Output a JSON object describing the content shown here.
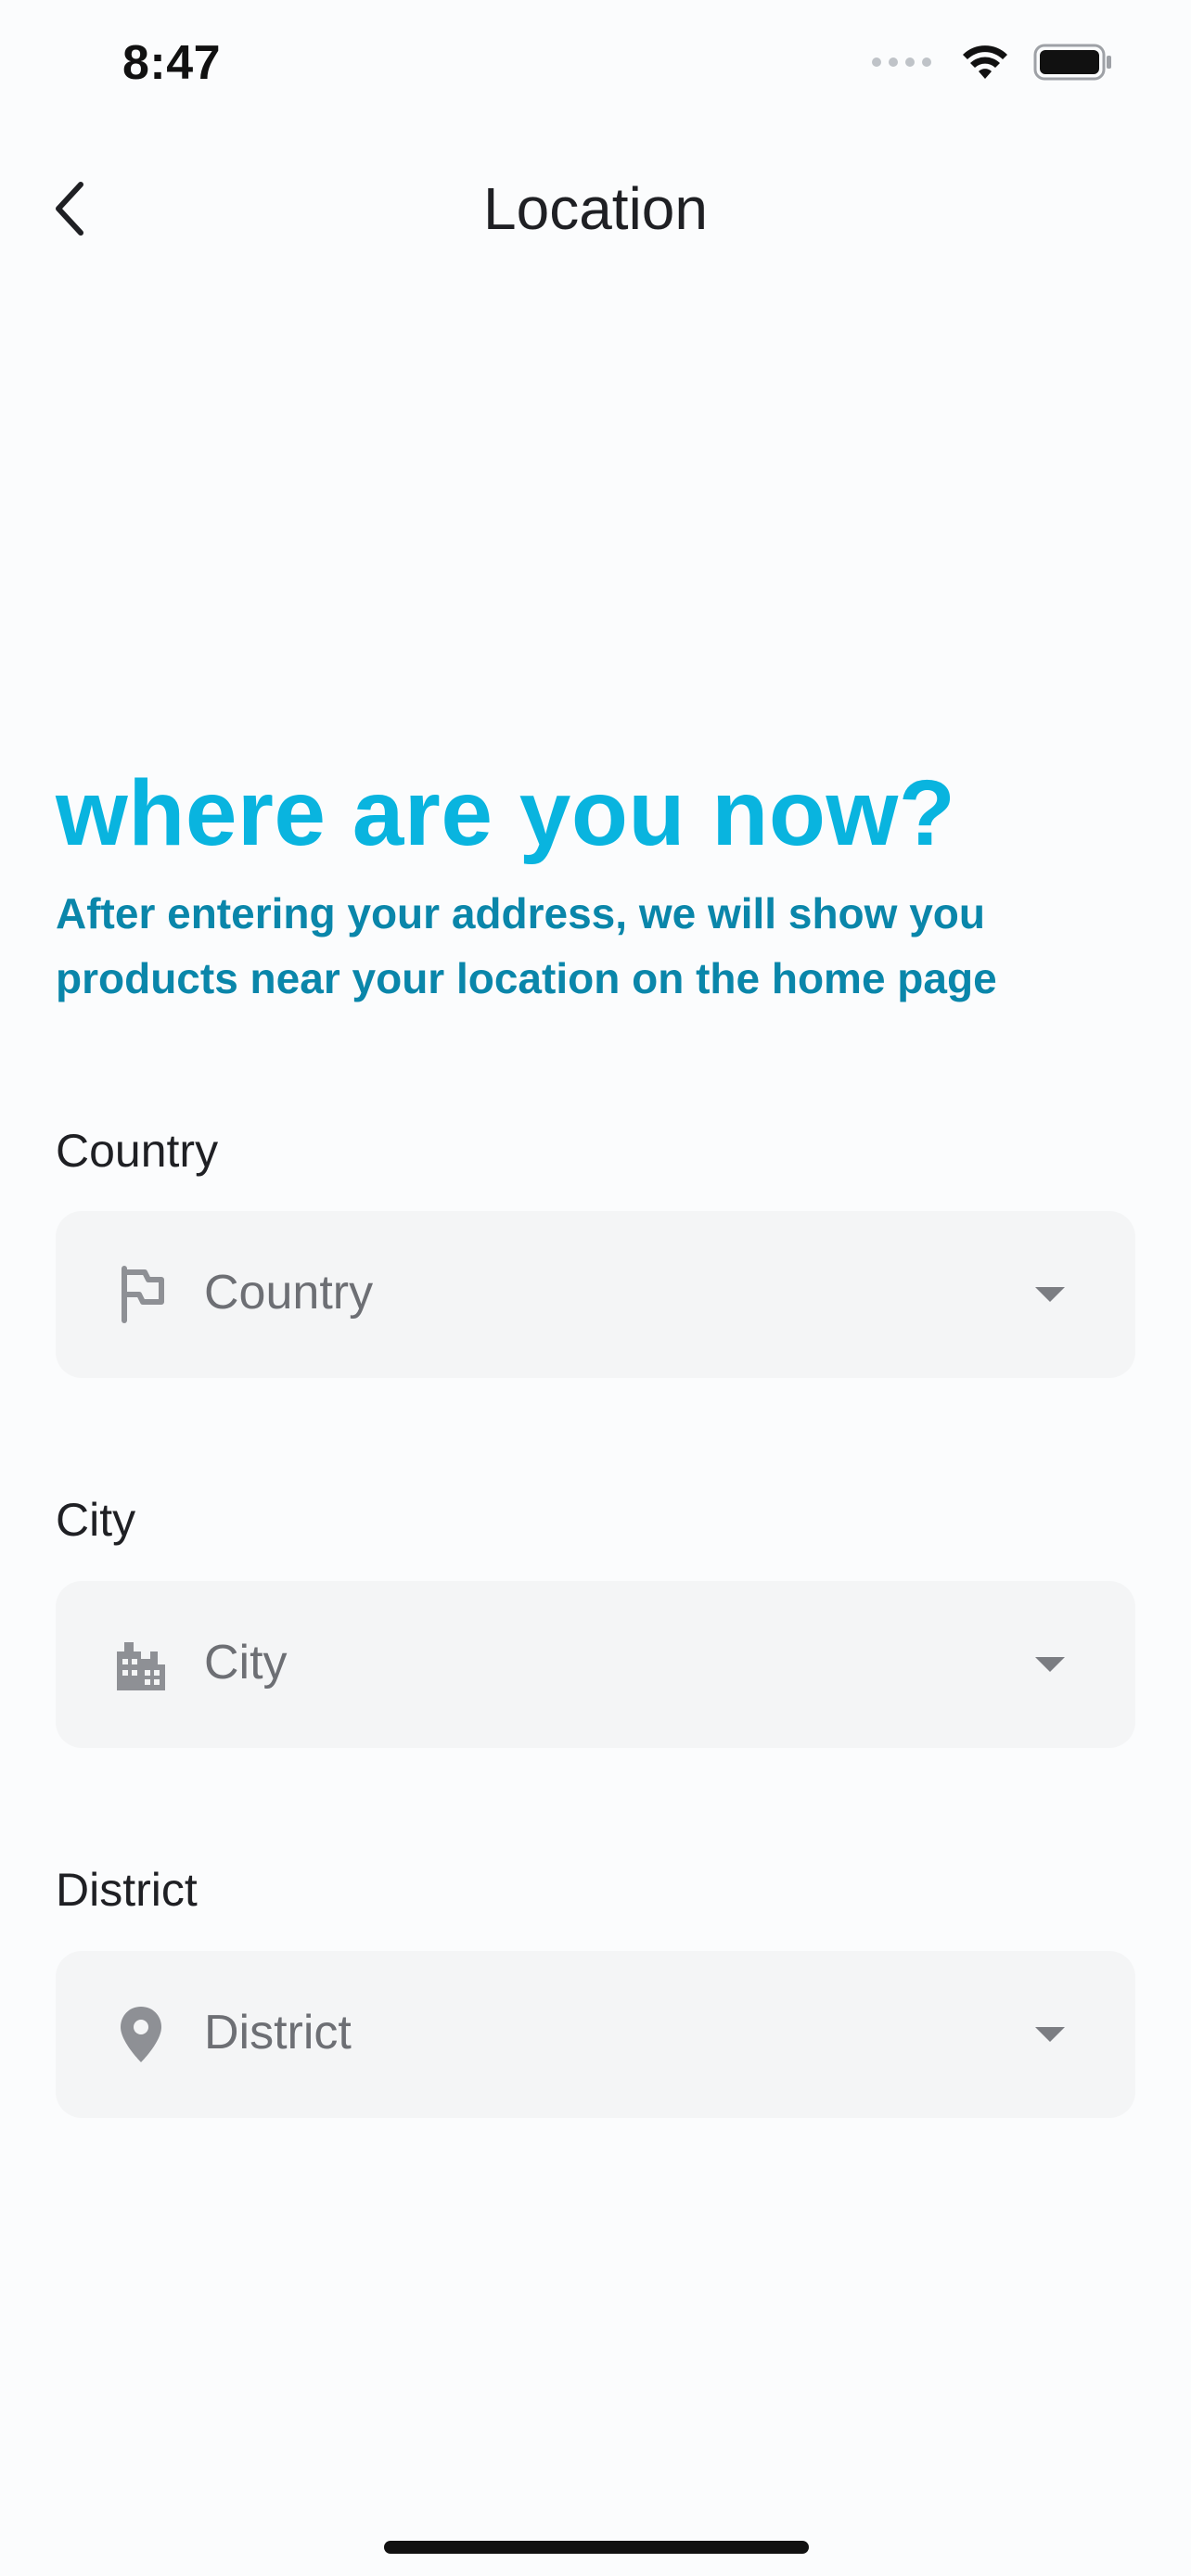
{
  "status_bar": {
    "time": "8:47"
  },
  "nav": {
    "title": "Location",
    "back_icon": "chevron-left-icon"
  },
  "intro": {
    "heading": "where are you now?",
    "subheading": "After entering your address, we will show you products near your location on the home page"
  },
  "fields": [
    {
      "label": "Country",
      "placeholder": "Country",
      "icon": "flag-icon"
    },
    {
      "label": "City",
      "placeholder": "City",
      "icon": "building-icon"
    },
    {
      "label": "District",
      "placeholder": "District",
      "icon": "map-pin-icon"
    }
  ],
  "colors": {
    "accent": "#09b4df",
    "accent_dark": "#0a86aa",
    "field_bg": "#f4f5f6",
    "background": "#fbfcfd"
  }
}
